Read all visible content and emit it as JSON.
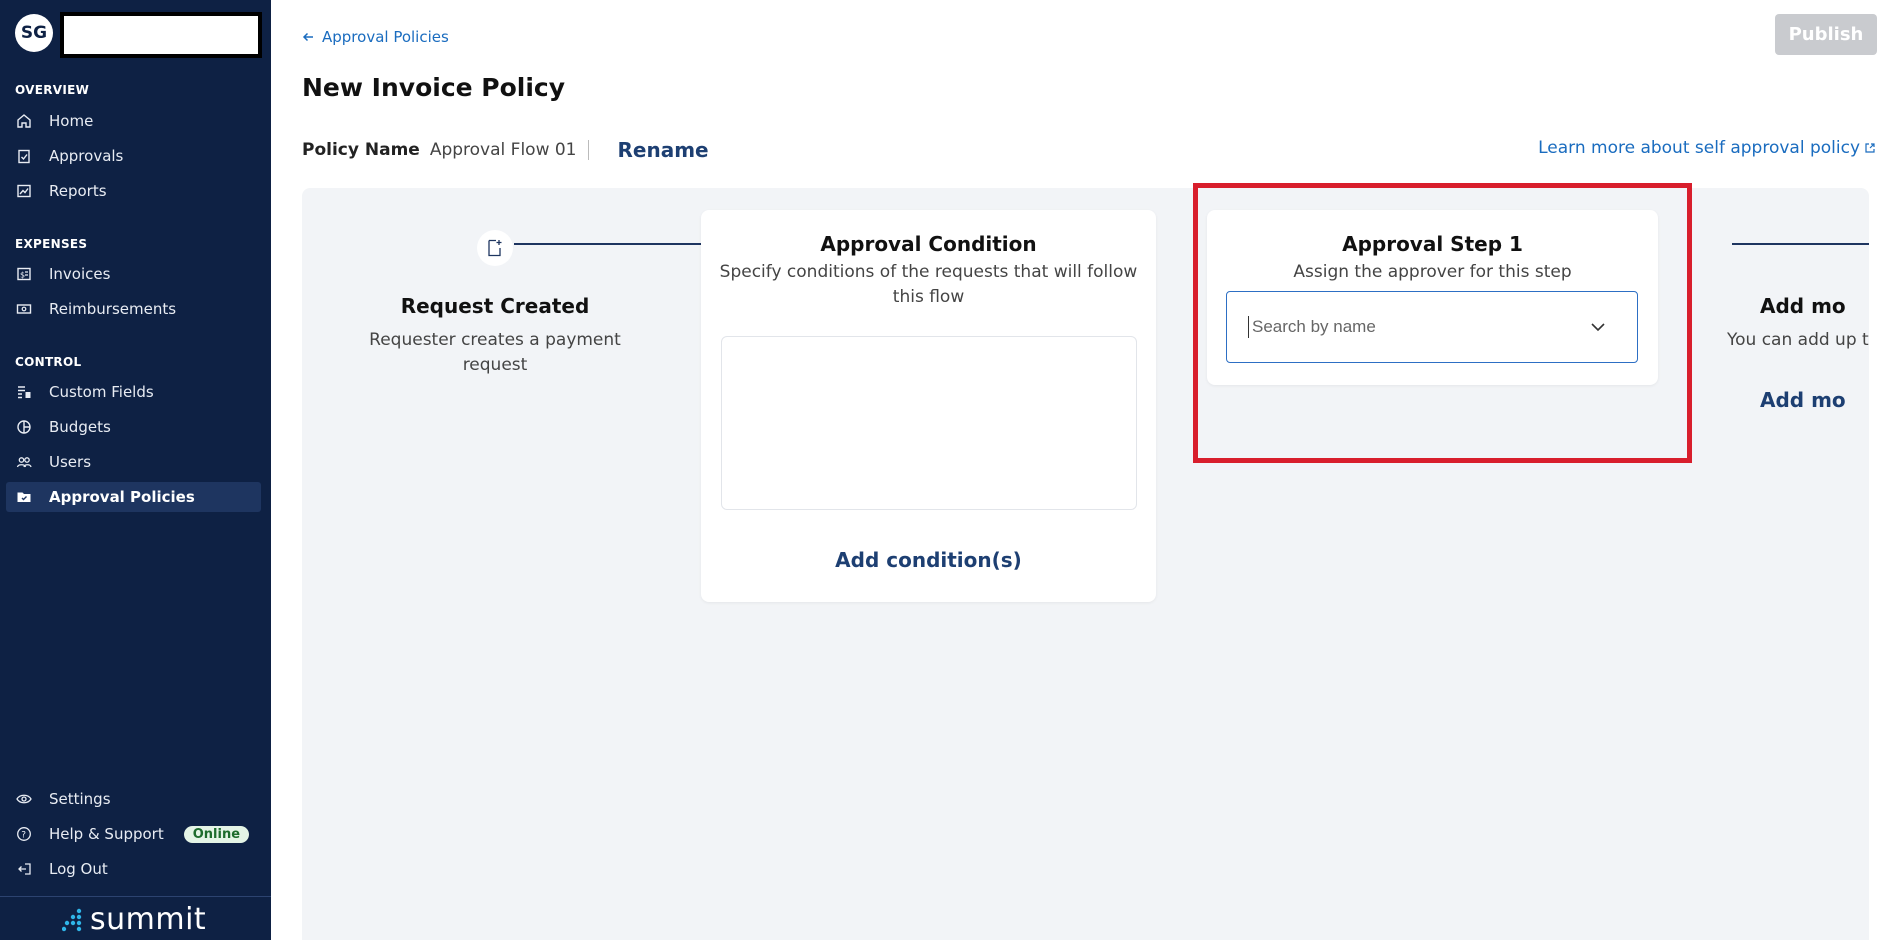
{
  "sidebar": {
    "avatar_initials": "SG",
    "sections": [
      {
        "label": "OVERVIEW"
      },
      {
        "label": "EXPENSES"
      },
      {
        "label": "CONTROL"
      }
    ],
    "items": [
      {
        "label": "Home",
        "icon": "home-icon"
      },
      {
        "label": "Approvals",
        "icon": "clipboard-check-icon"
      },
      {
        "label": "Reports",
        "icon": "chart-line-icon"
      },
      {
        "label": "Invoices",
        "icon": "invoice-icon"
      },
      {
        "label": "Reimbursements",
        "icon": "cash-icon"
      },
      {
        "label": "Custom Fields",
        "icon": "fields-icon"
      },
      {
        "label": "Budgets",
        "icon": "pie-chart-icon"
      },
      {
        "label": "Users",
        "icon": "users-icon"
      },
      {
        "label": "Approval Policies",
        "icon": "folder-icon",
        "active": true
      }
    ],
    "bottom_items": [
      {
        "label": "Settings",
        "icon": "eye-settings-icon"
      },
      {
        "label": "Help & Support",
        "icon": "help-icon",
        "badge": "Online"
      },
      {
        "label": "Log Out",
        "icon": "logout-icon"
      }
    ],
    "brand": "summit"
  },
  "header": {
    "back_label": "Approval Policies",
    "title": "New Invoice Policy",
    "publish_label": "Publish",
    "policy_name_label": "Policy Name",
    "policy_name_value": "Approval Flow 01",
    "rename_label": "Rename",
    "learn_more_label": "Learn more about self approval policy"
  },
  "flow": {
    "request_created": {
      "title": "Request Created",
      "desc_line1": "Requester creates a payment",
      "desc_line2": "request"
    },
    "approval_condition": {
      "title": "Approval Condition",
      "desc_line1": "Specify conditions of the requests that will follow",
      "desc_line2": "this flow",
      "add_label": "Add condition(s)"
    },
    "approval_step": {
      "title": "Approval Step 1",
      "desc": "Assign the approver for this step",
      "search_placeholder": "Search by name"
    },
    "add_more": {
      "title": "Add mo",
      "desc": "You can add up to",
      "link": "Add mo"
    }
  },
  "colors": {
    "sidebar_bg": "#0e2144",
    "link": "#1a6cbf",
    "accent_dark": "#1d3f72",
    "highlight": "#d81e2c",
    "publish_disabled": "#c9cbcf"
  }
}
